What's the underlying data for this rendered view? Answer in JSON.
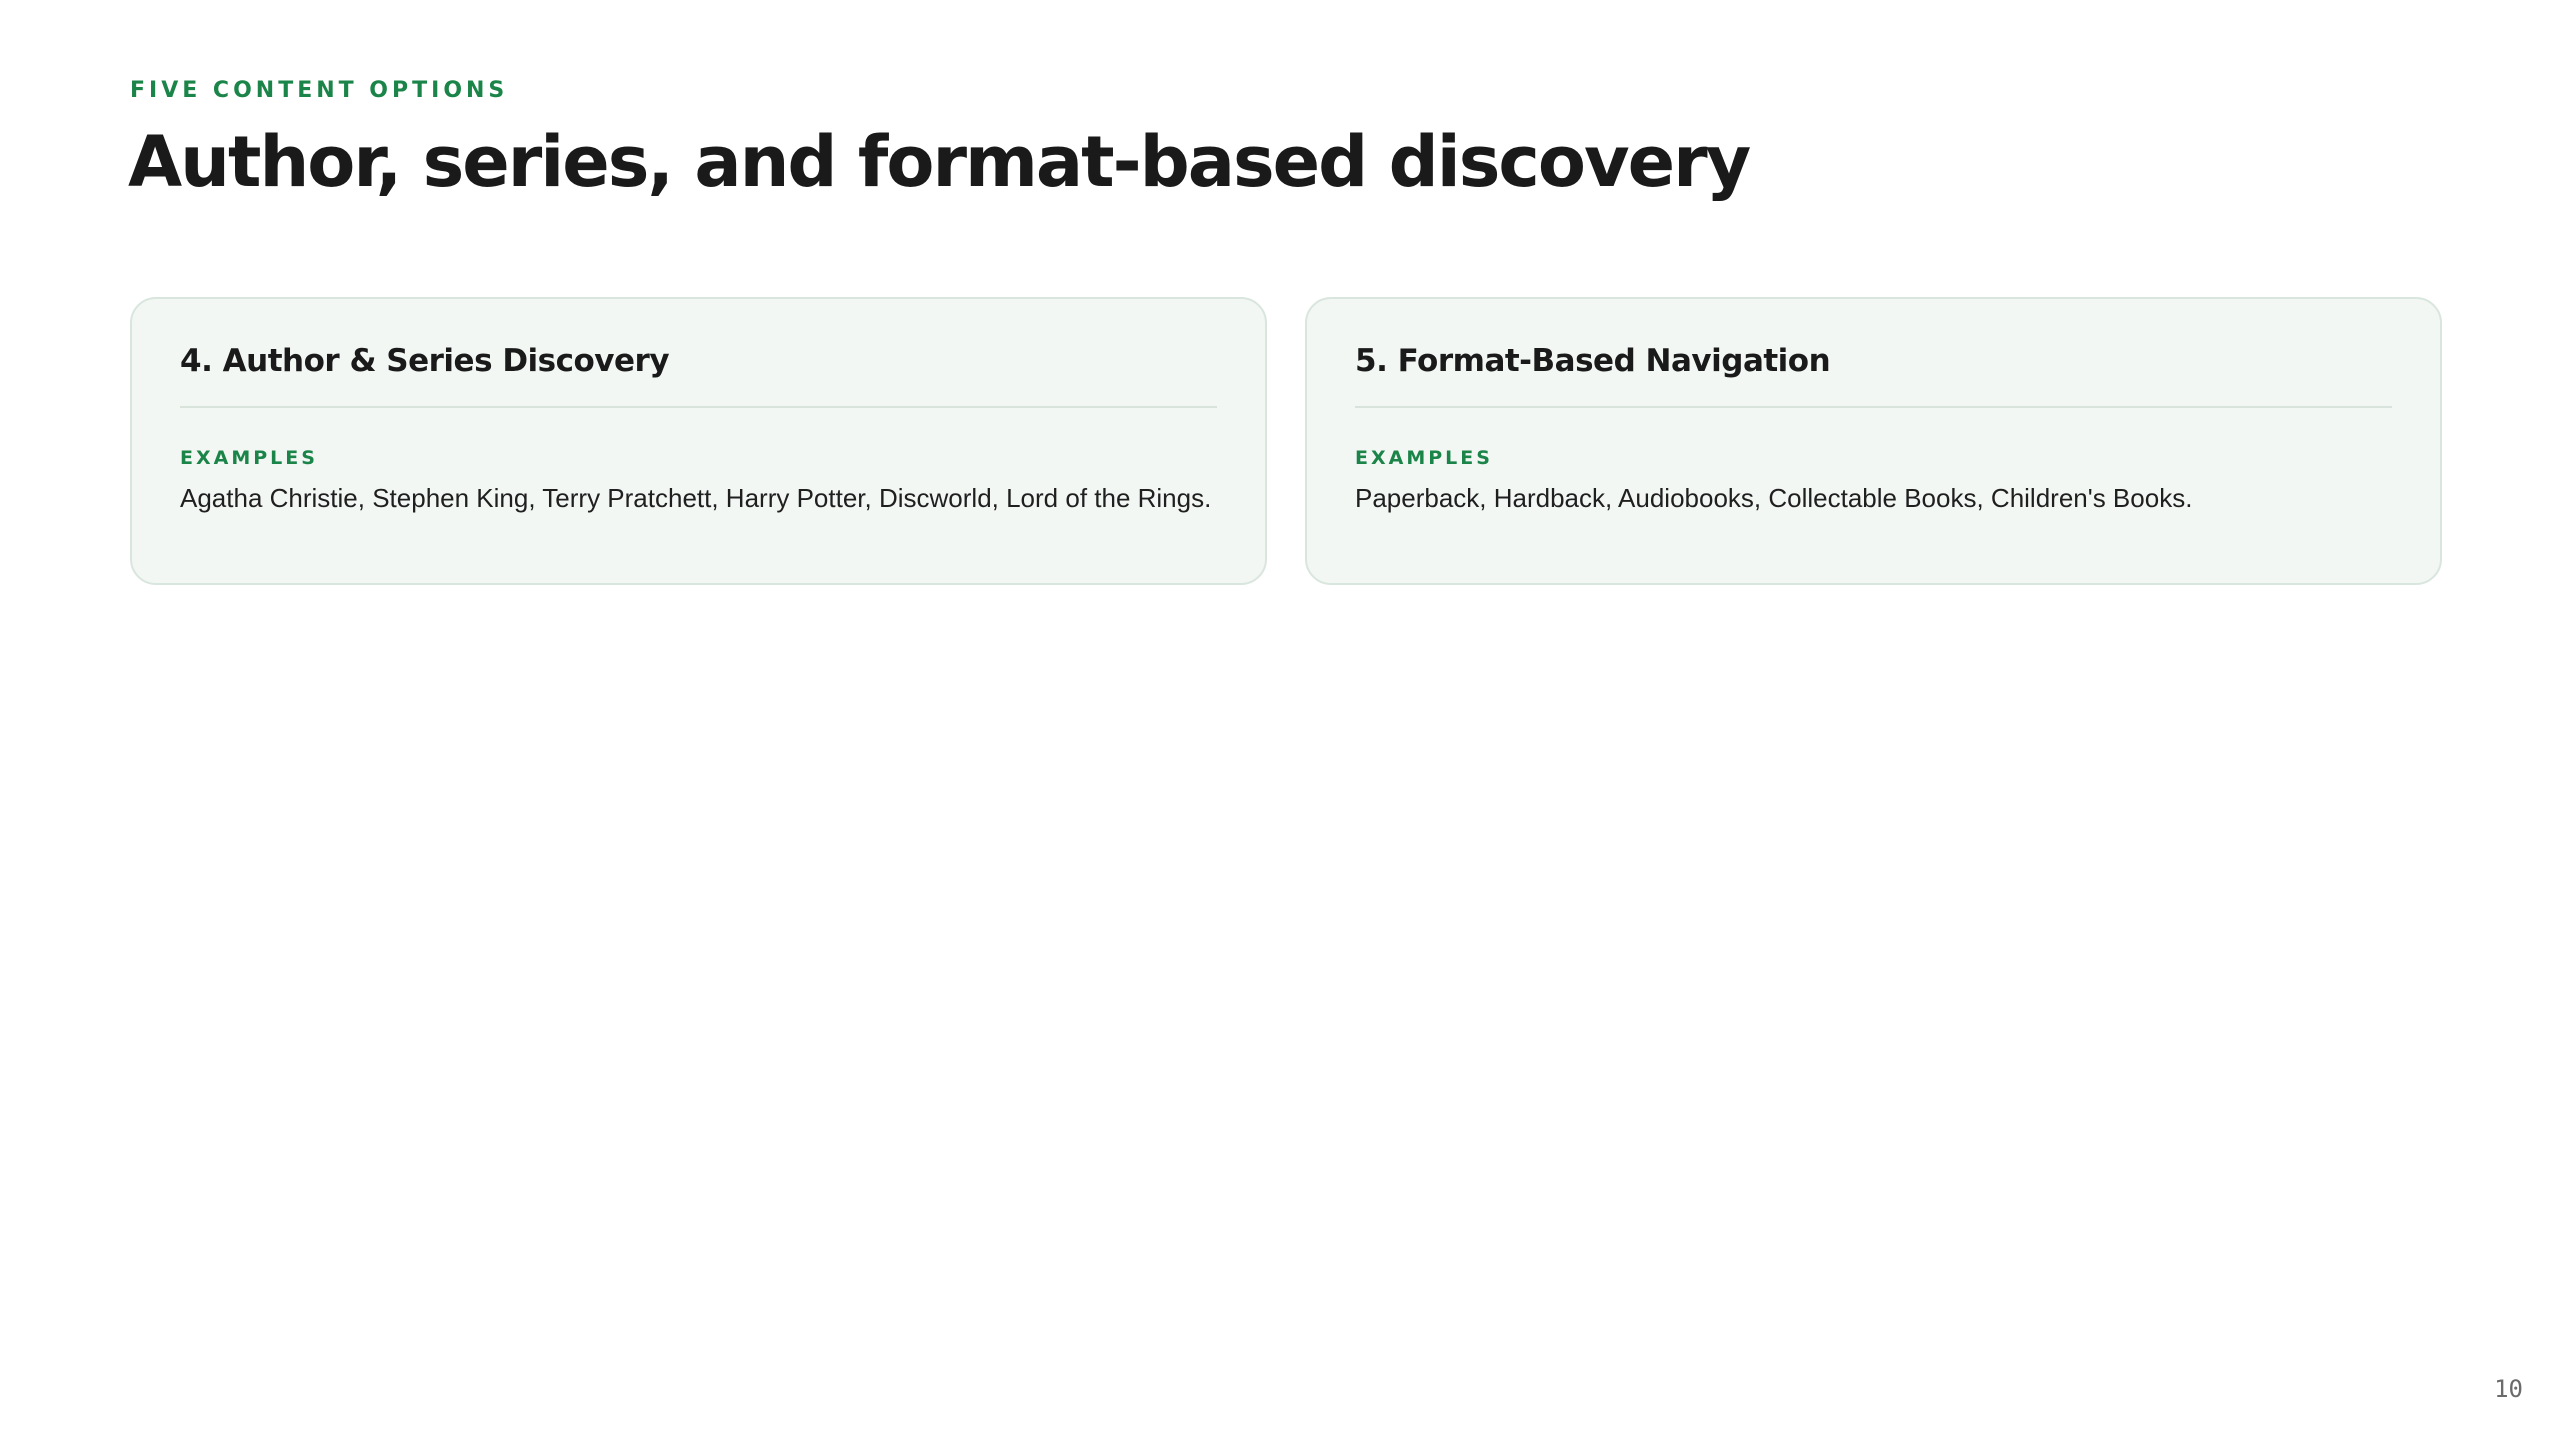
{
  "header": {
    "eyebrow": "FIVE CONTENT OPTIONS",
    "title": "Author, series, and format-based discovery"
  },
  "cards": [
    {
      "title": "4. Author & Series Discovery",
      "label": "EXAMPLES",
      "body": "Agatha Christie, Stephen King, Terry Pratchett, Harry Potter, Discworld, Lord of the Rings."
    },
    {
      "title": "5. Format-Based Navigation",
      "label": "EXAMPLES",
      "body": "Paperback, Hardback, Audiobooks, Collectable Books, Children's Books."
    }
  ],
  "footer": {
    "page_number": "10"
  },
  "colors": {
    "accent": "#1b8448",
    "card_background": "#f3f7f4",
    "card_border": "#d9e6de",
    "text": "#1a1a1a"
  }
}
